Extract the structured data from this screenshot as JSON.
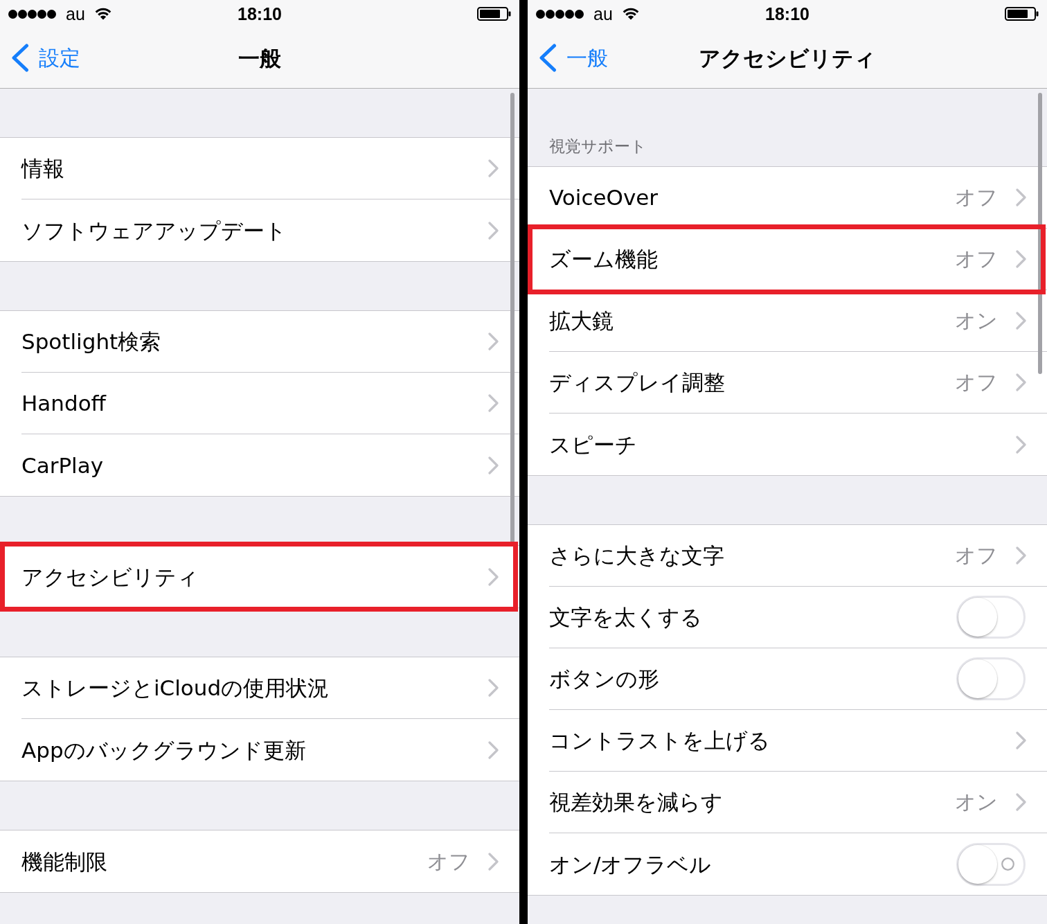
{
  "panels": [
    {
      "status_bar": {
        "carrier": "au",
        "time": "18:10"
      },
      "nav_bar": {
        "back": "設定",
        "title": "一般"
      },
      "groups": [
        {
          "rows": [
            {
              "kind": "disclosure",
              "label": "情報",
              "highlighted": false
            },
            {
              "kind": "disclosure",
              "label": "ソフトウェアアップデート",
              "highlighted": false
            }
          ]
        },
        {
          "rows": [
            {
              "kind": "disclosure",
              "label": "Spotlight検索",
              "highlighted": false
            },
            {
              "kind": "disclosure",
              "label": "Handoff",
              "highlighted": false
            },
            {
              "kind": "disclosure",
              "label": "CarPlay",
              "highlighted": false
            }
          ]
        },
        {
          "rows": [
            {
              "kind": "disclosure",
              "label": "アクセシビリティ",
              "highlighted": true
            }
          ]
        },
        {
          "rows": [
            {
              "kind": "disclosure",
              "label": "ストレージとiCloudの使用状況",
              "highlighted": false
            },
            {
              "kind": "disclosure",
              "label": "Appのバックグラウンド更新",
              "highlighted": false
            }
          ]
        },
        {
          "rows": [
            {
              "kind": "disclosure",
              "label": "機能制限",
              "value": "オフ",
              "highlighted": false
            }
          ]
        }
      ]
    },
    {
      "status_bar": {
        "carrier": "au",
        "time": "18:10"
      },
      "nav_bar": {
        "back": "一般",
        "title": "アクセシビリティ"
      },
      "groups": [
        {
          "header": "視覚サポート",
          "rows": [
            {
              "kind": "disclosure",
              "label": "VoiceOver",
              "value": "オフ",
              "highlighted": false
            },
            {
              "kind": "disclosure",
              "label": "ズーム機能",
              "value": "オフ",
              "highlighted": true
            },
            {
              "kind": "disclosure",
              "label": "拡大鏡",
              "value": "オン",
              "highlighted": false
            },
            {
              "kind": "disclosure",
              "label": "ディスプレイ調整",
              "value": "オフ",
              "highlighted": false
            },
            {
              "kind": "disclosure",
              "label": "スピーチ",
              "highlighted": false
            }
          ]
        },
        {
          "rows": [
            {
              "kind": "disclosure",
              "label": "さらに大きな文字",
              "value": "オフ",
              "highlighted": false
            },
            {
              "kind": "toggle",
              "label": "文字を太くする",
              "on": false,
              "labels": false,
              "highlighted": false
            },
            {
              "kind": "toggle",
              "label": "ボタンの形",
              "on": false,
              "labels": false,
              "highlighted": false
            },
            {
              "kind": "disclosure",
              "label": "コントラストを上げる",
              "highlighted": false
            },
            {
              "kind": "disclosure",
              "label": "視差効果を減らす",
              "value": "オン",
              "highlighted": false
            },
            {
              "kind": "toggle",
              "label": "オン/オフラベル",
              "on": false,
              "labels": true,
              "highlighted": false
            }
          ]
        }
      ]
    }
  ]
}
